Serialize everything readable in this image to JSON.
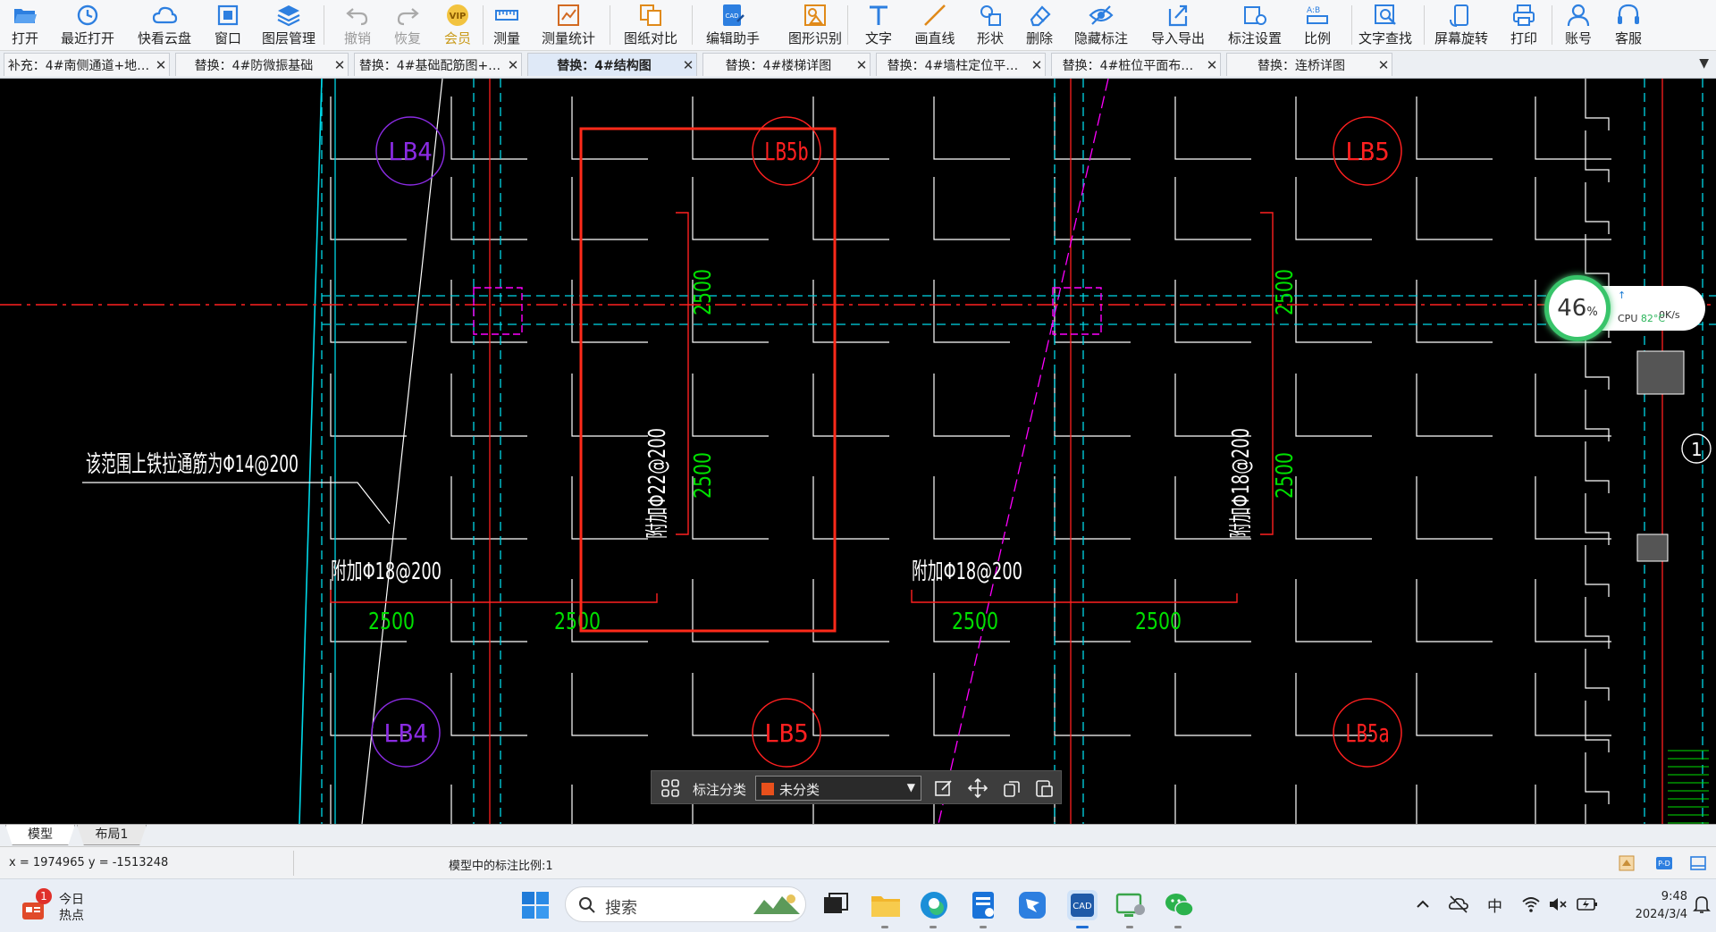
{
  "toolbar": {
    "items": [
      {
        "label": "打开",
        "icon": "folder-open-icon"
      },
      {
        "label": "最近打开",
        "icon": "recent-clock-icon"
      },
      {
        "label": "快看云盘",
        "icon": "cloud-icon"
      },
      {
        "label": "窗口",
        "icon": "window-icon"
      },
      {
        "label": "图层管理",
        "icon": "layers-icon"
      },
      {
        "label": "撤销",
        "icon": "undo-icon"
      },
      {
        "label": "恢复",
        "icon": "redo-icon"
      },
      {
        "label": "会员",
        "icon": "vip-icon"
      },
      {
        "label": "测量",
        "icon": "ruler-icon"
      },
      {
        "label": "测量统计",
        "icon": "measure-stats-icon"
      },
      {
        "label": "图纸对比",
        "icon": "compare-icon"
      },
      {
        "label": "编辑助手",
        "icon": "cad-edit-icon"
      },
      {
        "label": "图形识别",
        "icon": "shape-recognize-icon"
      },
      {
        "label": "文字",
        "icon": "text-icon"
      },
      {
        "label": "画直线",
        "icon": "line-icon"
      },
      {
        "label": "形状",
        "icon": "shapes-icon"
      },
      {
        "label": "删除",
        "icon": "eraser-icon"
      },
      {
        "label": "隐藏标注",
        "icon": "eye-off-icon"
      },
      {
        "label": "导入导出",
        "icon": "export-icon"
      },
      {
        "label": "标注设置",
        "icon": "annotation-settings-icon"
      },
      {
        "label": "比例",
        "icon": "scale-icon"
      },
      {
        "label": "文字查找",
        "icon": "text-search-icon"
      },
      {
        "label": "屏幕旋转",
        "icon": "rotate-screen-icon"
      },
      {
        "label": "打印",
        "icon": "printer-icon"
      },
      {
        "label": "账号",
        "icon": "user-icon"
      },
      {
        "label": "客服",
        "icon": "headset-icon"
      }
    ]
  },
  "tabs": [
    {
      "label": "补充：4#南侧通道+地…"
    },
    {
      "label": "替换：4#防微振基础"
    },
    {
      "label": "替换：4#基础配筋图+…"
    },
    {
      "label": "替换：4#结构图"
    },
    {
      "label": "替换：4#楼梯详图"
    },
    {
      "label": "替换：4#墙柱定位平…"
    },
    {
      "label": "替换：4#桩位平面布…"
    },
    {
      "label": "替换：连桥详图"
    }
  ],
  "tab_close": "✕",
  "tab_overflow": "▼",
  "drawing": {
    "labels": {
      "lb4_top": "LB4",
      "lb5b_top": "LB5b",
      "lb5_top_right": "LB5",
      "lb4_bottom": "LB4",
      "lb5_bottom": "LB5",
      "lb5a_bottom": "LB5a",
      "note": "该范围上铁拉通筋为Φ14@200",
      "rebar_left": "附加Φ18@200",
      "rebar_mid": "附加Φ18@200",
      "rebar_vert_1": "附加Φ22@200",
      "rebar_vert_2": "附加Φ18@200",
      "dim": "2500",
      "axis_mark": "1"
    },
    "colors": {
      "grid": "#ffffff",
      "axis_red": "#ff2020",
      "axis_cyan": "#00d8e8",
      "dim_green": "#00e000",
      "lb4": "#8a2be2",
      "lb5": "#ff2020",
      "highlight": "#ff2a1a",
      "magenta": "#ff00ff"
    }
  },
  "perf": {
    "percent": "46",
    "percent_unit": "%",
    "net": "0K/s",
    "cpu_label": "CPU",
    "cpu_temp": "82°C",
    "plus": "+"
  },
  "annot_bar": {
    "label": "标注分类",
    "value": "未分类",
    "caret": "▼"
  },
  "layout_tabs": {
    "model": "模型",
    "layout1": "布局1"
  },
  "status": {
    "coords": "x = 1974965  y = -1513248",
    "scale": "模型中的标注比例:1"
  },
  "taskbar": {
    "news_badge": "1",
    "news_title": "今日",
    "news_sub": "热点",
    "search_placeholder": "搜索",
    "ime": "中",
    "time": "9:48",
    "date": "2024/3/4"
  }
}
